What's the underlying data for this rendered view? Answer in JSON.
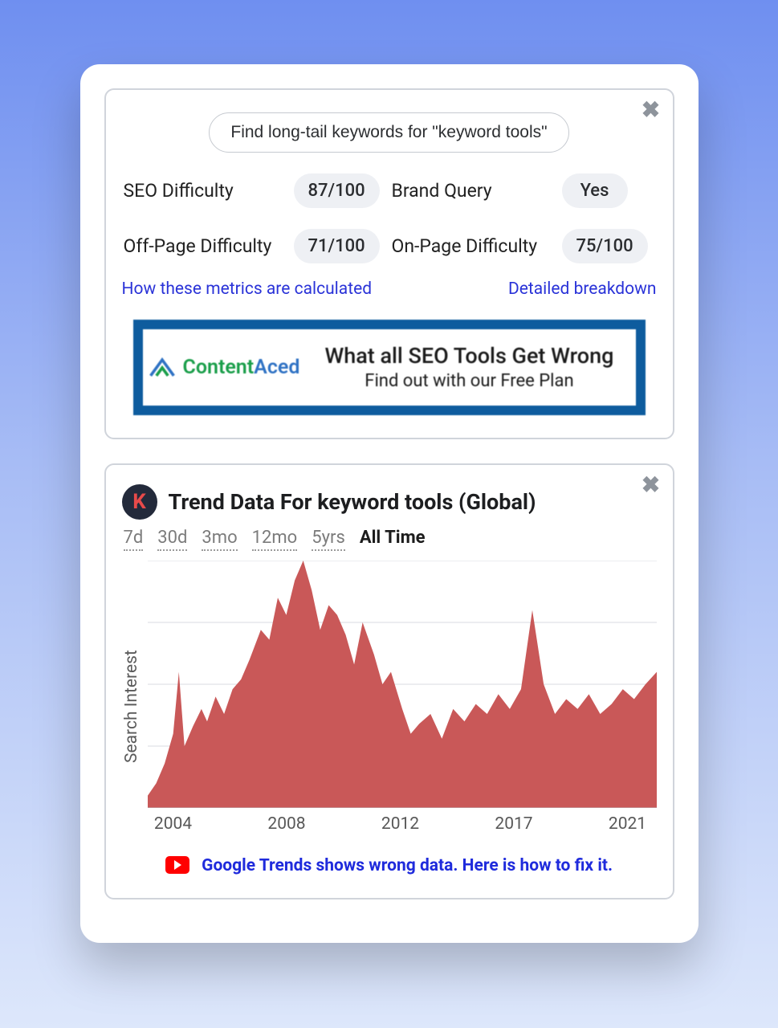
{
  "card1": {
    "cta": "Find long-tail keywords for \"keyword tools\"",
    "metrics": [
      {
        "label": "SEO Difficulty",
        "value": "87/100"
      },
      {
        "label": "Brand Query",
        "value": "Yes"
      },
      {
        "label": "Off-Page Difficulty",
        "value": "71/100"
      },
      {
        "label": "On-Page Difficulty",
        "value": "75/100"
      }
    ],
    "link_how": "How these metrics are calculated",
    "link_detail": "Detailed breakdown",
    "ad": {
      "brand_a": "Content",
      "brand_b": "Aced",
      "line1": "What all SEO Tools Get Wrong",
      "line2": "Find out with our Free Plan"
    }
  },
  "card2": {
    "badge": "K",
    "title": "Trend Data For keyword tools (Global)",
    "ranges": [
      "7d",
      "30d",
      "3mo",
      "12mo",
      "5yrs",
      "All Time"
    ],
    "active_range": "All Time",
    "ylabel": "Search Interest",
    "xticks": [
      "2004",
      "2008",
      "2012",
      "2017",
      "2021"
    ],
    "footer": {
      "text": "Google Trends shows wrong data. Here is how to fix it."
    }
  },
  "chart_data": {
    "type": "area",
    "title": "Trend Data For keyword tools (Global)",
    "xlabel": "",
    "ylabel": "Search Interest",
    "ylim": [
      0,
      100
    ],
    "xlim": [
      2004,
      2022
    ],
    "x": [
      2004.0,
      2004.3,
      2004.6,
      2004.9,
      2005.1,
      2005.3,
      2005.6,
      2005.9,
      2006.1,
      2006.4,
      2006.7,
      2007.0,
      2007.3,
      2007.6,
      2008.0,
      2008.3,
      2008.6,
      2008.9,
      2009.2,
      2009.5,
      2009.8,
      2010.1,
      2010.4,
      2010.7,
      2011.0,
      2011.3,
      2011.6,
      2012.0,
      2012.3,
      2012.6,
      2013.0,
      2013.3,
      2013.6,
      2014.0,
      2014.4,
      2014.8,
      2015.2,
      2015.6,
      2016.0,
      2016.4,
      2016.8,
      2017.2,
      2017.6,
      2018.0,
      2018.4,
      2018.8,
      2019.2,
      2019.6,
      2020.0,
      2020.4,
      2020.8,
      2021.2,
      2021.6,
      2022.0
    ],
    "y": [
      5,
      10,
      18,
      30,
      55,
      25,
      33,
      40,
      35,
      45,
      38,
      48,
      52,
      60,
      72,
      68,
      85,
      78,
      92,
      100,
      88,
      72,
      82,
      78,
      70,
      58,
      75,
      62,
      50,
      55,
      40,
      30,
      34,
      38,
      28,
      40,
      35,
      42,
      38,
      46,
      40,
      48,
      80,
      50,
      38,
      44,
      40,
      46,
      38,
      42,
      48,
      44,
      50,
      55
    ]
  }
}
